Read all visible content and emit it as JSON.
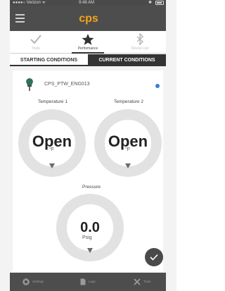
{
  "status_bar": {
    "carrier": "●●●●○ Verizon ᯤ",
    "time": "9:48 AM",
    "bluetooth": "✱"
  },
  "app_bar": {
    "logo_text": "cps",
    "brand_color": "#f2a31b"
  },
  "tabs": [
    {
      "label": "Tools",
      "icon": "check-icon",
      "active": false
    },
    {
      "label": "Performance",
      "icon": "star-icon",
      "active": true
    },
    {
      "label": "Device List",
      "icon": "bluetooth-icon",
      "active": false
    }
  ],
  "segments": {
    "starting": "STARTING CONDITIONS",
    "current": "CURRENT CONDITIONS"
  },
  "device": {
    "name": "CPS_PTW_ENG013",
    "status_color": "#3b7ddb"
  },
  "gauges": {
    "temp1": {
      "label": "Temperature 1",
      "value": "Open",
      "unit": "°F"
    },
    "temp2": {
      "label": "Temperature 2",
      "value": "Open",
      "unit": "°F"
    },
    "pressure": {
      "label": "Pressure",
      "value": "0.0",
      "unit": "Psig"
    }
  },
  "bottom_nav": [
    {
      "label": "Settings",
      "icon": "gear-icon"
    },
    {
      "label": "Logs",
      "icon": "document-icon"
    },
    {
      "label": "Tools",
      "icon": "wrench-icon"
    }
  ]
}
